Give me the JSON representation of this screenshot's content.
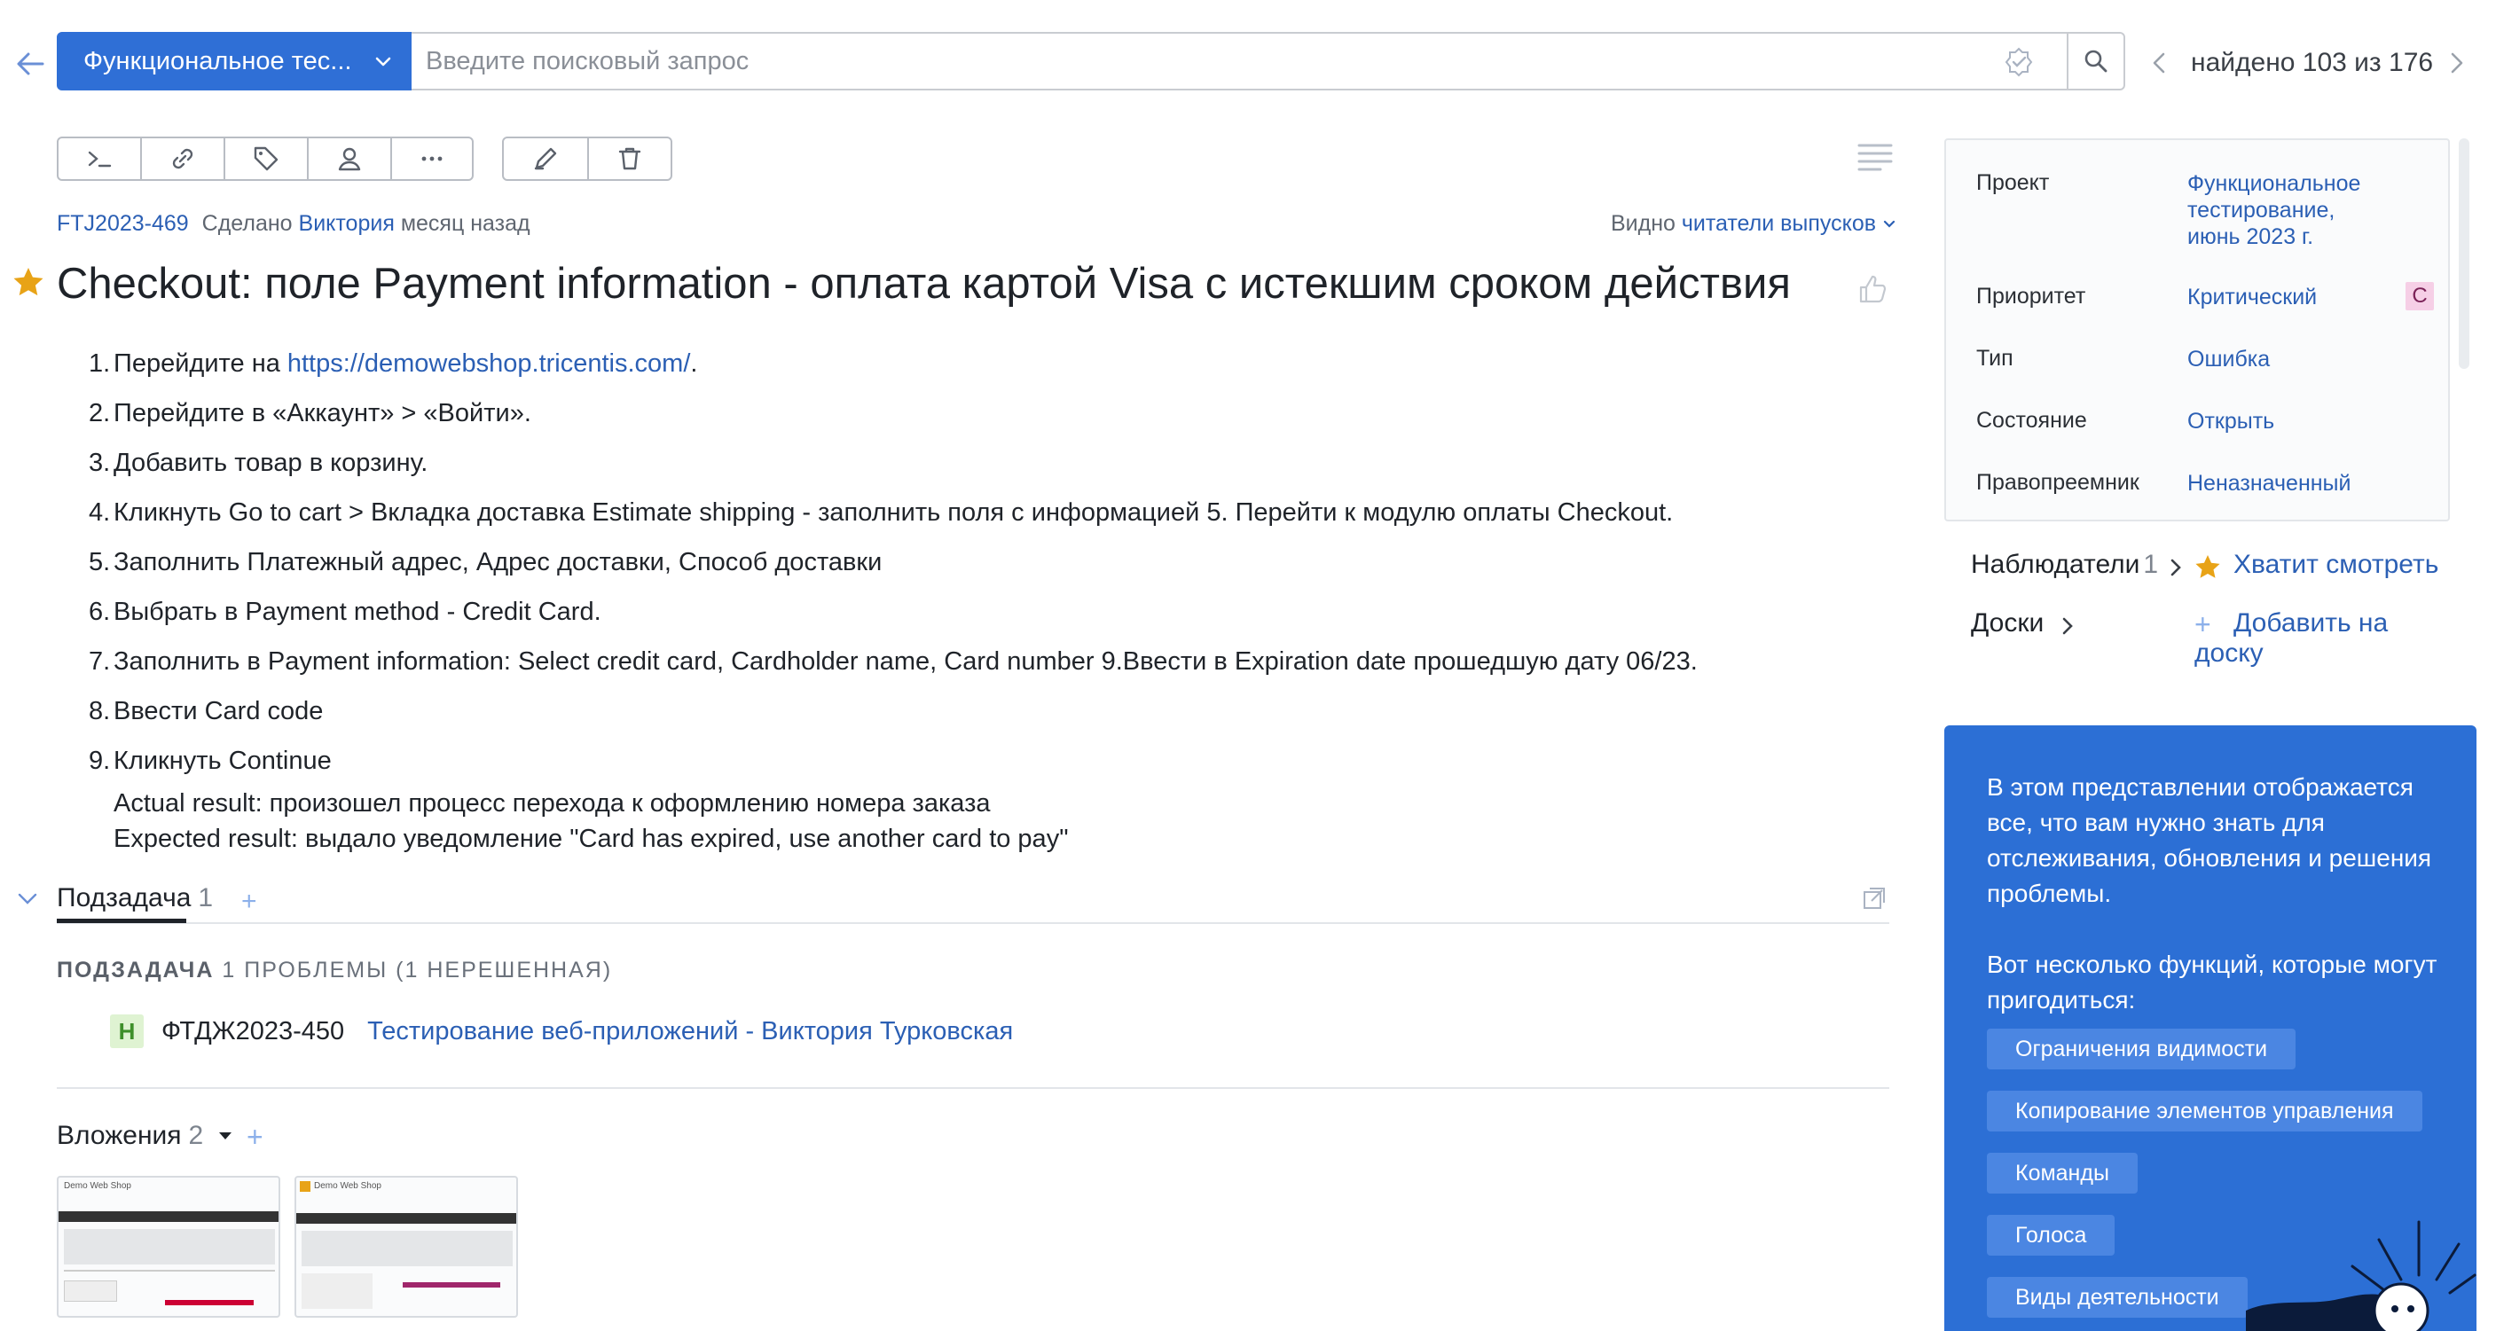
{
  "search": {
    "project_label": "Функциональное тес...",
    "placeholder": "Введите поисковый запрос",
    "found_text": "найдено 103 из 176"
  },
  "issue": {
    "id": "FTJ2023-469",
    "done_prefix": "Сделано",
    "author": "Виктория",
    "time_ago": "месяц назад",
    "visibility_prefix": "Видно",
    "visibility_value": "читатели выпусков",
    "title": "Checkout: поле Payment information - оплата картой Visa с истекшим сроком действия"
  },
  "steps": [
    {
      "num": "1.",
      "text": "Перейдите на ",
      "link": "https://demowebshop.tricentis.com/",
      "suffix": " ."
    },
    {
      "num": "2.",
      "text": "Перейдите в «Аккаунт» > «Войти»."
    },
    {
      "num": "3.",
      "text": "Добавить товар в корзину."
    },
    {
      "num": "4.",
      "text": "Кликнуть Go to cart > Вкладка доставка Estimate shipping - заполнить поля с информацией 5. Перейти к модулю оплаты Checkout."
    },
    {
      "num": "5.",
      "text": "Заполнить Платежный адрес, Адрес доставки, Способ доставки"
    },
    {
      "num": "6.",
      "text": "Выбрать в Payment method - Credit Card."
    },
    {
      "num": "7.",
      "text": "Заполнить в Payment information: Select credit card, Cardholder name, Card number 9.Ввести в Expiration date прошедшую дату 06/23."
    },
    {
      "num": "8.",
      "text": "Ввести Card code"
    },
    {
      "num": "9.",
      "text": "Кликнуть Continue"
    }
  ],
  "results": {
    "actual": "Actual result: произошел процесс перехода к оформлению номера заказа",
    "expected": "Expected result: выдало уведомление \"Card has expired, use another card to pay\""
  },
  "subtask": {
    "tab_label": "Подзадача",
    "count": "1",
    "header_bold": "ПОДЗАДАЧА",
    "header_rest": " 1 ПРОБЛЕМЫ (1 НЕРЕШЕННАЯ)",
    "badge": "Н",
    "item_id": "ФТДЖ2023-450",
    "item_title": "Тестирование веб-приложений - Виктория Турковская"
  },
  "attachments": {
    "label": "Вложения",
    "count": "2",
    "thumb1_site": "Demo Web Shop",
    "thumb2_site": "Demo Web Shop"
  },
  "fields": {
    "project_label": "Проект",
    "project_value": "Функциональное тестирование, июнь 2023 г.",
    "priority_label": "Приоритет",
    "priority_value": "Критический",
    "priority_badge": "С",
    "type_label": "Тип",
    "type_value": "Ошибка",
    "state_label": "Состояние",
    "state_value": "Открыть",
    "assignee_label": "Правопреемник",
    "assignee_value": "Неназначенный"
  },
  "sidebar": {
    "watchers_label": "Наблюдатели",
    "watchers_count": "1",
    "stop_watching": "Хватит смотреть",
    "boards_label": "Доски",
    "add_board": "Добавить на доску"
  },
  "info": {
    "p1": "В этом представлении отображается все, что вам нужно знать для отслеживания, обновления и решения проблемы.",
    "p2": "Вот несколько функций, которые могут пригодиться:",
    "buttons": [
      "Ограничения видимости",
      "Копирование элементов управления",
      "Команды",
      "Голоса",
      "Виды деятельности"
    ]
  },
  "colors": {
    "accent": "#2f6fd6",
    "link": "#2b5fb4",
    "info_bg": "#2c6fd5",
    "star": "#e8a317",
    "priority_badge_bg": "#f6cfe6"
  }
}
